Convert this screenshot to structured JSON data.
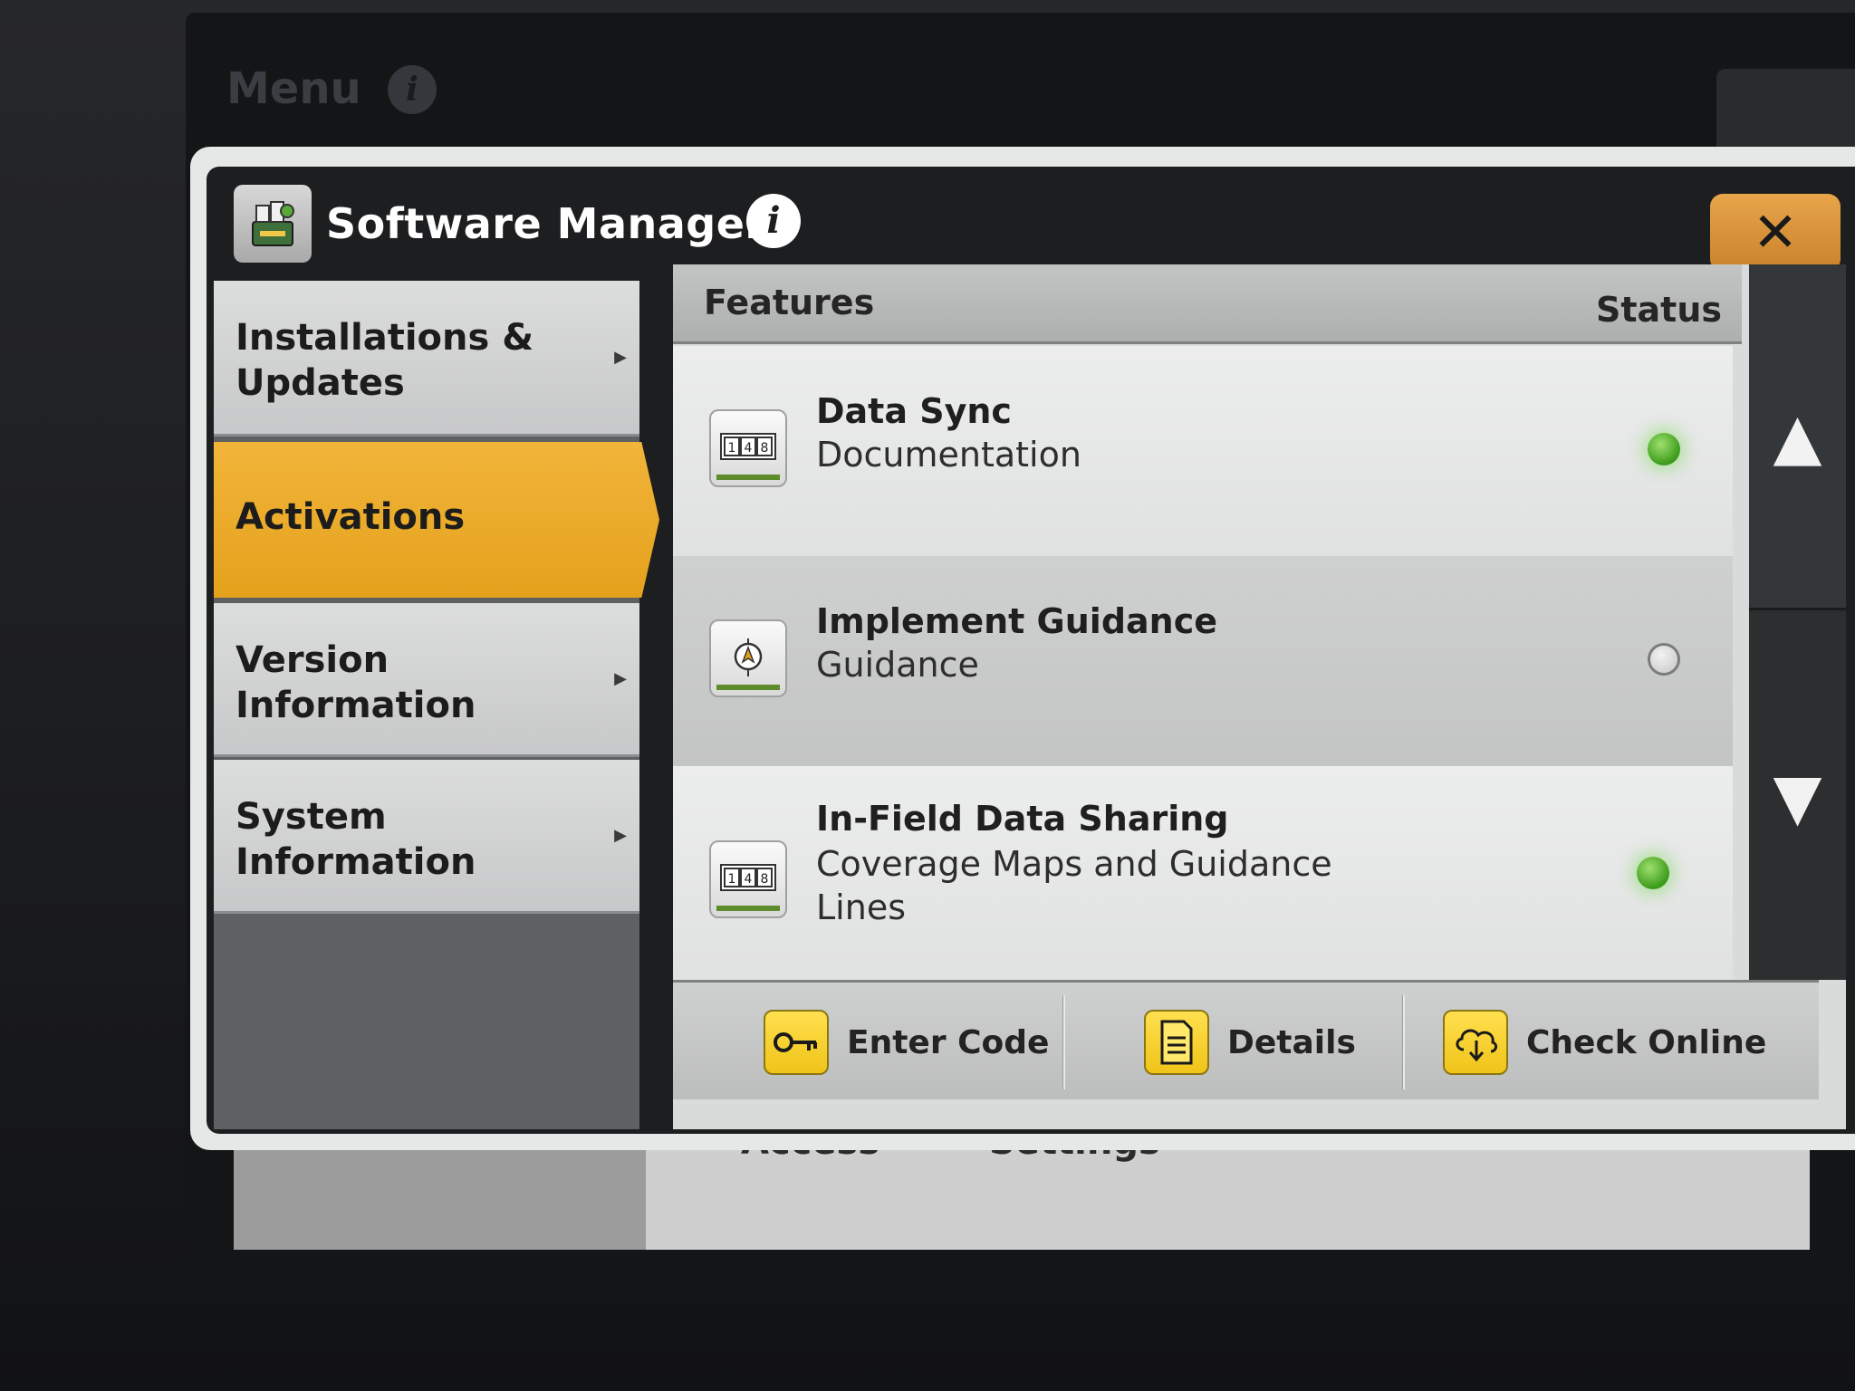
{
  "background": {
    "menu_title": "Menu",
    "under_labels": [
      "Access",
      "Settings"
    ]
  },
  "modal": {
    "title": "Software Manager",
    "close_label": "✕"
  },
  "nav": {
    "items": [
      {
        "label_line1": "Installations &",
        "label_line2": "Updates",
        "active": false
      },
      {
        "label_line1": "Activations",
        "label_line2": "",
        "active": true
      },
      {
        "label_line1": "Version",
        "label_line2": "Information",
        "active": false
      },
      {
        "label_line1": "System",
        "label_line2": "Information",
        "active": false
      }
    ]
  },
  "table": {
    "col_features": "Features",
    "col_status": "Status",
    "rows": [
      {
        "title": "Data Sync",
        "subtitle": "Documentation",
        "status": "active",
        "icon": "counter-icon"
      },
      {
        "title": "Implement Guidance",
        "subtitle": "Guidance",
        "status": "inactive",
        "icon": "guidance-icon"
      },
      {
        "title": "In-Field Data Sharing",
        "subtitle": "Coverage Maps and Guidance Lines",
        "status": "active",
        "icon": "counter-icon"
      }
    ]
  },
  "toolbar": {
    "enter_code": "Enter Code",
    "details": "Details",
    "check_online": "Check Online"
  },
  "colors": {
    "accent": "#e4a11c",
    "close": "#d48f34",
    "status_on": "#3b9b1a",
    "tool_icon": "#f0c419"
  }
}
